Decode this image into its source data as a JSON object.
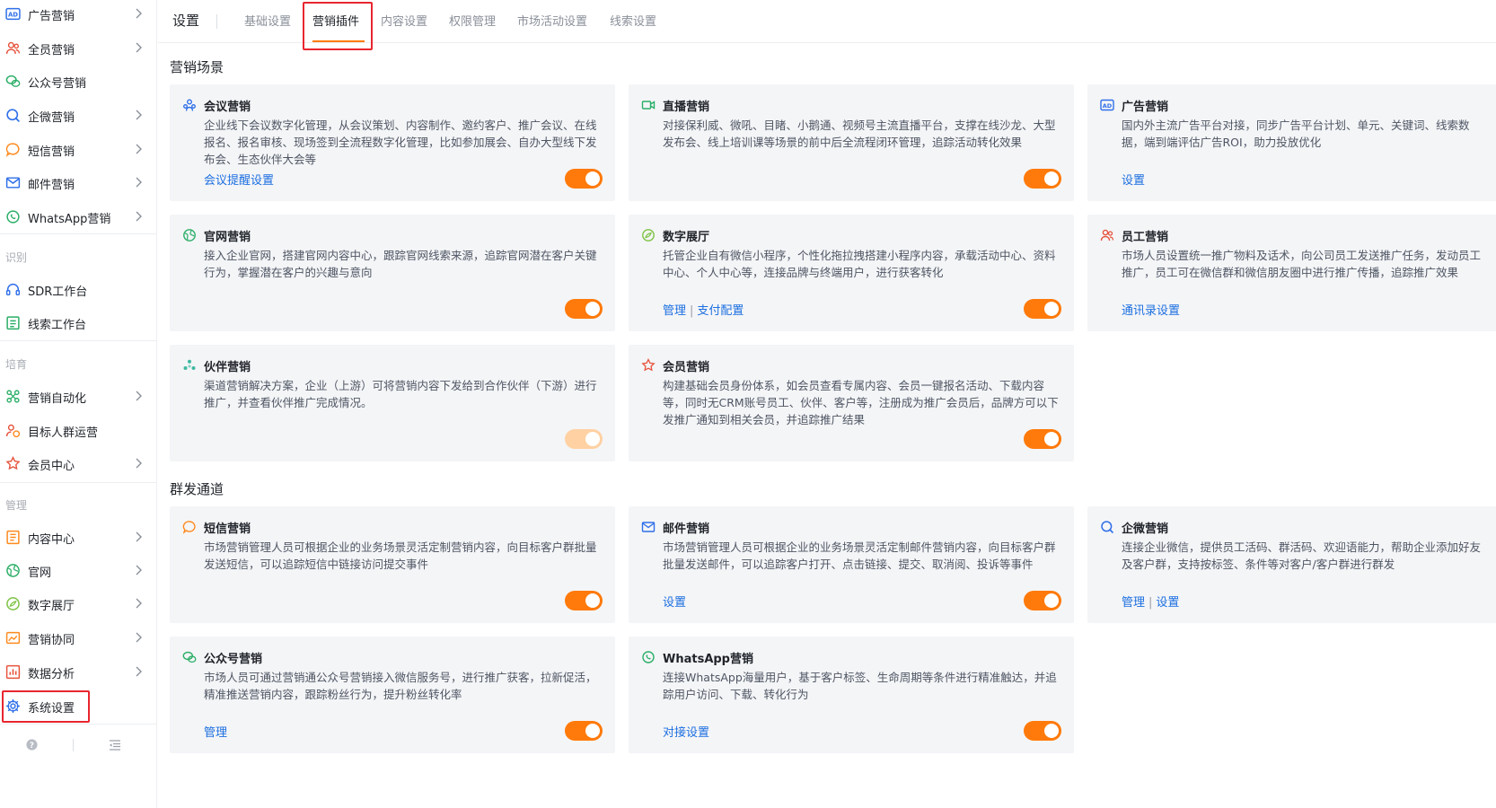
{
  "sidebar": {
    "groups": [
      {
        "section": "",
        "items": [
          {
            "label": "广告营销",
            "icon": "ad-icon",
            "chevron": true
          },
          {
            "label": "全员营销",
            "icon": "staff-icon",
            "chevron": true
          },
          {
            "label": "公众号营销",
            "icon": "wechat-icon",
            "chevron": false
          },
          {
            "label": "企微营销",
            "icon": "wecom-icon",
            "chevron": true
          },
          {
            "label": "短信营销",
            "icon": "sms-icon",
            "chevron": true
          },
          {
            "label": "邮件营销",
            "icon": "mail-icon",
            "chevron": true
          },
          {
            "label": "WhatsApp营销",
            "icon": "whatsapp-icon",
            "chevron": true
          }
        ]
      },
      {
        "section": "识别",
        "items": [
          {
            "label": "SDR工作台",
            "icon": "headset-icon",
            "chevron": false
          },
          {
            "label": "线索工作台",
            "icon": "clipboard-icon",
            "chevron": false
          }
        ]
      },
      {
        "section": "培育",
        "items": [
          {
            "label": "营销自动化",
            "icon": "automation-icon",
            "chevron": true
          },
          {
            "label": "目标人群运营",
            "icon": "audience-icon",
            "chevron": false
          },
          {
            "label": "会员中心",
            "icon": "member-icon",
            "chevron": true
          }
        ]
      },
      {
        "section": "管理",
        "items": [
          {
            "label": "内容中心",
            "icon": "content-icon",
            "chevron": true
          },
          {
            "label": "官网",
            "icon": "website-icon",
            "chevron": true
          },
          {
            "label": "数字展厅",
            "icon": "showroom-icon",
            "chevron": true
          },
          {
            "label": "营销协同",
            "icon": "collab-icon",
            "chevron": true
          },
          {
            "label": "数据分析",
            "icon": "chart-icon",
            "chevron": true
          },
          {
            "label": "系统设置",
            "icon": "gear-icon",
            "chevron": false
          }
        ]
      }
    ],
    "footer": {
      "help_icon": "help-icon",
      "collapse_icon": "collapse-icon"
    }
  },
  "header": {
    "title": "设置",
    "tabs": [
      "基础设置",
      "营销插件",
      "内容设置",
      "权限管理",
      "市场活动设置",
      "线索设置"
    ],
    "active_tab": "营销插件"
  },
  "sections": [
    {
      "title": "营销场景",
      "cards": [
        {
          "title": "会议营销",
          "icon": "meeting-icon",
          "desc": "企业线下会议数字化管理，从会议策划、内容制作、邀约客户、推广会议、在线报名、报名审核、现场签到全流程数字化管理，比如参加展会、自办大型线下发布会、生态伙伴大会等",
          "links": [
            "会议提醒设置"
          ],
          "enabled": true
        },
        {
          "title": "直播营销",
          "icon": "live-icon",
          "desc": "对接保利威、微吼、目睹、小鹅通、视频号主流直播平台，支撑在线沙龙、大型发布会、线上培训课等场景的前中后全流程闭环管理，追踪活动转化效果",
          "links": [],
          "enabled": true
        },
        {
          "title": "广告营销",
          "icon": "ad-icon",
          "desc": "国内外主流广告平台对接，同步广告平台计划、单元、关键词、线索数据，端到端评估广告ROI，助力投放优化",
          "links": [
            "设置"
          ],
          "enabled": true
        },
        {
          "title": "官网营销",
          "icon": "website-icon",
          "desc": "接入企业官网，搭建官网内容中心，跟踪官网线索来源，追踪官网潜在客户关键行为，掌握潜在客户的兴趣与意向",
          "links": [],
          "enabled": true
        },
        {
          "title": "数字展厅",
          "icon": "showroom-icon",
          "desc": "托管企业自有微信小程序，个性化拖拉拽搭建小程序内容，承载活动中心、资料中心、个人中心等，连接品牌与终端用户，进行获客转化",
          "links": [
            "管理",
            "支付配置"
          ],
          "enabled": true
        },
        {
          "title": "员工营销",
          "icon": "staff-icon",
          "desc": "市场人员设置统一推广物料及话术，向公司员工发送推广任务，发动员工推广，员工可在微信群和微信朋友圈中进行推广传播，追踪推广效果",
          "links": [
            "通讯录设置"
          ],
          "enabled": true
        },
        {
          "title": "伙伴营销",
          "icon": "partner-icon",
          "desc": "渠道营销解决方案，企业（上游）可将营销内容下发给到合作伙伴（下游）进行推广，并查看伙伴推广完成情况。",
          "links": [],
          "enabled": false
        },
        {
          "title": "会员营销",
          "icon": "member-icon",
          "desc": "构建基础会员身份体系，如会员查看专属内容、会员一键报名活动、下载内容等，同时无CRM账号员工、伙伴、客户等，注册成为推广会员后，品牌方可以下发推广通知到相关会员，并追踪推广结果",
          "links": [],
          "enabled": true
        }
      ]
    },
    {
      "title": "群发通道",
      "cards": [
        {
          "title": "短信营销",
          "icon": "sms-icon",
          "desc": "市场营销管理人员可根据企业的业务场景灵活定制营销内容，向目标客户群批量发送短信，可以追踪短信中链接访问提交事件",
          "links": [],
          "enabled": true
        },
        {
          "title": "邮件营销",
          "icon": "mail-icon",
          "desc": "市场营销管理人员可根据企业的业务场景灵活定制邮件营销内容，向目标客户群批量发送邮件，可以追踪客户打开、点击链接、提交、取消阅、投诉等事件",
          "links": [
            "设置"
          ],
          "enabled": true
        },
        {
          "title": "企微营销",
          "icon": "wecom-icon",
          "desc": "连接企业微信，提供员工活码、群活码、欢迎语能力，帮助企业添加好友及客户群，支持按标签、条件等对客户/客户群进行群发",
          "links": [
            "管理",
            "设置"
          ],
          "enabled": true
        },
        {
          "title": "公众号营销",
          "icon": "wechat-icon",
          "desc": "市场人员可通过营销通公众号营销接入微信服务号，进行推广获客，拉新促活，精准推送营销内容，跟踪粉丝行为，提升粉丝转化率",
          "links": [
            "管理"
          ],
          "enabled": true
        },
        {
          "title": "WhatsApp营销",
          "icon": "whatsapp-icon",
          "desc": "连接WhatsApp海量用户，基于客户标签、生命周期等条件进行精准触达，并追踪用户访问、下载、转化行为",
          "links": [
            "对接设置"
          ],
          "enabled": true
        }
      ]
    }
  ],
  "colors": {
    "accent": "#ff7a0a",
    "link": "#1c6fe0",
    "card_bg": "#f4f5f7",
    "highlight": "#e8262f"
  }
}
